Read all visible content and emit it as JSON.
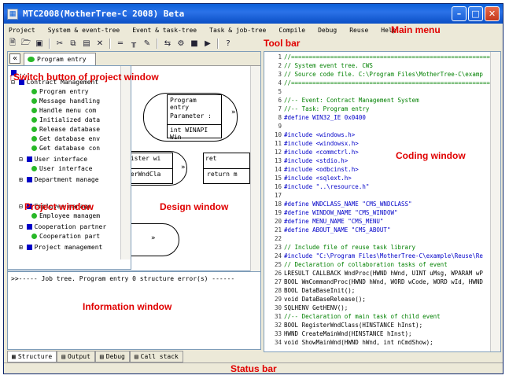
{
  "window": {
    "title": "MTC2008(MotherTree-C 2008) Beta"
  },
  "menu": [
    "Project",
    "System & event-tree",
    "Event & task-tree",
    "Task & job-tree",
    "Compile",
    "Debug",
    "Reuse",
    "Help"
  ],
  "labels": {
    "main_menu": "Main menu",
    "tool_bar": "Tool bar",
    "switch_button": "↑Switch button of project window",
    "project_window": "Project window",
    "design_window": "Design window",
    "coding_window": "Coding window",
    "information_window": "Information window",
    "status_bar": "Status bar"
  },
  "left_tab": {
    "label": "Program entry"
  },
  "project_tree": [
    "Contract Management",
    "Program entry",
    "Message handling",
    "Handle menu com",
    "Initialized data",
    "Release database",
    "Get database env",
    "Get database con",
    "User interface",
    "User interface",
    "Department manage",
    "Employee manage",
    "Employee managem",
    "Cooperation partner",
    "Cooperation part",
    "Project management"
  ],
  "design": {
    "entry_line1": "Program entry",
    "entry_line2": "Parameter :",
    "entry_line3": "int WINAPI Win",
    "register_line1": "gister wi",
    "register_line2": "terWndCla",
    "return_label": "return m",
    "ret_label": "ret"
  },
  "info": {
    "message": ">>----- Job tree. Program entry 0 structure error(s) ------"
  },
  "bottom_tabs": [
    "Structure",
    "Output",
    "Debug",
    "Call stack"
  ],
  "code_lines": [
    {
      "n": "1",
      "t": "//============================================================"
    },
    {
      "n": "2",
      "t": "// System event tree. CWS"
    },
    {
      "n": "3",
      "t": "// Source code file. C:\\Program Files\\MotherTree-C\\examp"
    },
    {
      "n": "4",
      "t": "//============================================================"
    },
    {
      "n": "5",
      "t": ""
    },
    {
      "n": "6",
      "t": "//-- Event: Contract Management System"
    },
    {
      "n": "7",
      "t": "//-- Task: Program entry"
    },
    {
      "n": "8",
      "t": "#define  WIN32_IE    0x0400"
    },
    {
      "n": "9",
      "t": ""
    },
    {
      "n": "10",
      "t": "#include <windows.h>"
    },
    {
      "n": "11",
      "t": "#include <windowsx.h>"
    },
    {
      "n": "12",
      "t": "#include <commctrl.h>"
    },
    {
      "n": "13",
      "t": "#include <stdio.h>"
    },
    {
      "n": "14",
      "t": "#include <odbcinst.h>"
    },
    {
      "n": "15",
      "t": "#include <sqlext.h>"
    },
    {
      "n": "16",
      "t": "#include \"..\\resource.h\""
    },
    {
      "n": "17",
      "t": ""
    },
    {
      "n": "18",
      "t": "#define  WNDCLASS_NAME      \"CMS_WNDCLASS\""
    },
    {
      "n": "19",
      "t": "#define  WINDOW_NAME        \"CMS_WINDOW\""
    },
    {
      "n": "20",
      "t": "#define  MENU_NAME          \"CMS_MENU\""
    },
    {
      "n": "21",
      "t": "#define  ABOUT_NAME         \"CMS_ABOUT\""
    },
    {
      "n": "22",
      "t": ""
    },
    {
      "n": "23",
      "t": "//    Include file of reuse task library"
    },
    {
      "n": "24",
      "t": "#include \"C:\\Program Files\\MotherTree-C\\example\\Reuse\\Re"
    },
    {
      "n": "25",
      "t": "//    Declaration of collaboration tasks of event"
    },
    {
      "n": "26",
      "t": "LRESULT CALLBACK WndProc(HWND hWnd, UINT uMsg, WPARAM wP"
    },
    {
      "n": "27",
      "t": "BOOL WmCommandProc(HWND hWnd, WORD wCode, WORD wId, HWND"
    },
    {
      "n": "28",
      "t": "BOOL DataBaseInit();"
    },
    {
      "n": "29",
      "t": "void DataBaseRelease();"
    },
    {
      "n": "30",
      "t": "SQLHENV GetHENV();"
    },
    {
      "n": "31",
      "t": "//-- Declaration of main task of child event"
    },
    {
      "n": "32",
      "t": "BOOL RegisterWndClass(HINSTANCE hInst);"
    },
    {
      "n": "33",
      "t": "HWND CreateMainWnd(HINSTANCE hInst);"
    },
    {
      "n": "34",
      "t": "void ShowMainWnd(HWND hWnd, int nCmdShow);"
    }
  ],
  "colors": {
    "annotation": "#e00000",
    "comment": "#008000",
    "keyword": "#0000c8",
    "string": "#a00000",
    "tree_blue": "#0000c8",
    "tree_green": "#28b828"
  }
}
